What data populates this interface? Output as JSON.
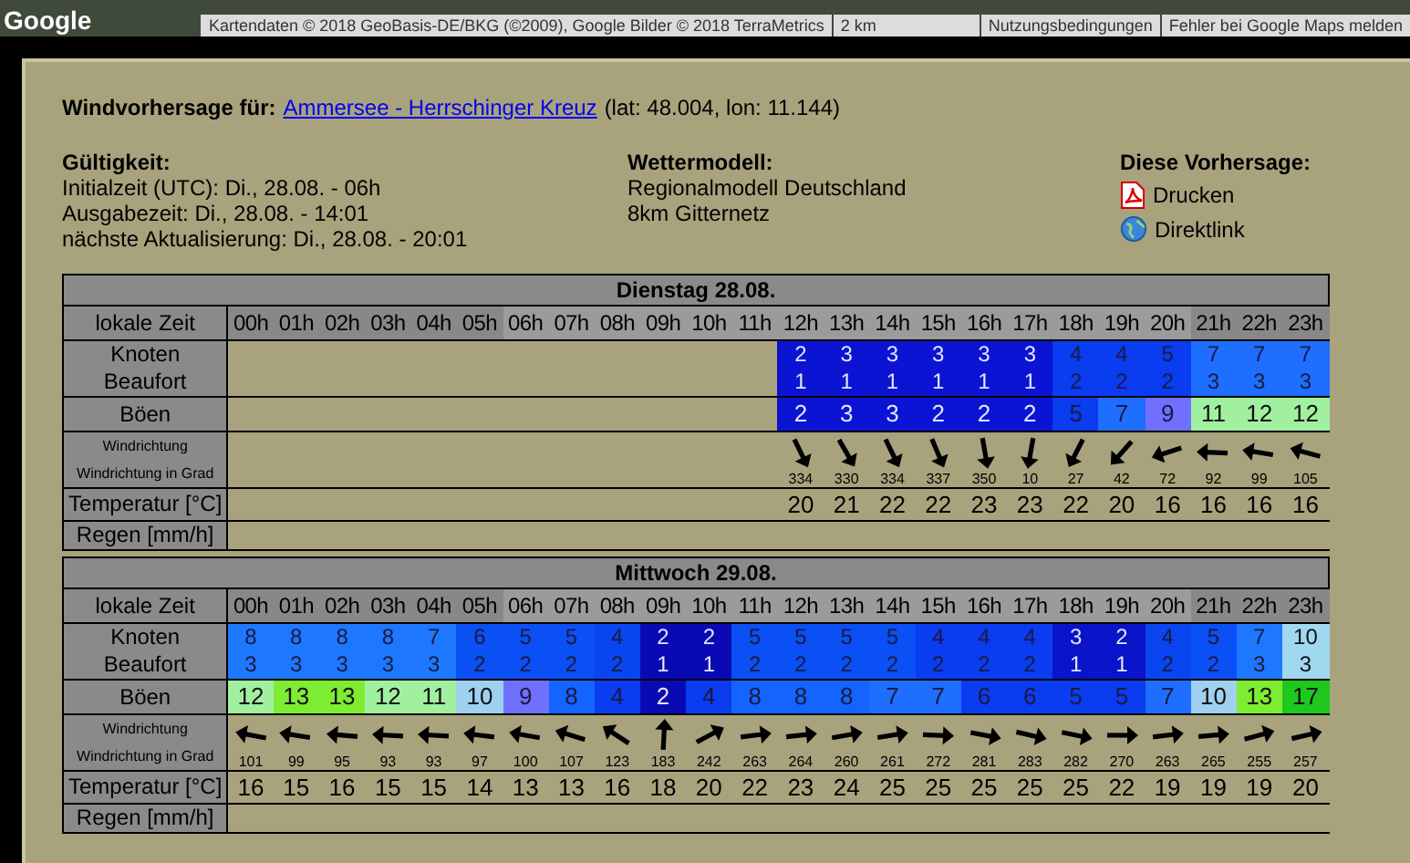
{
  "map": {
    "logo": "Google",
    "attribution": "Kartendaten © 2018 GeoBasis-DE/BKG (©2009), Google Bilder © 2018 TerraMetrics",
    "scale": "2 km",
    "terms": "Nutzungsbedingungen",
    "report": "Fehler bei Google Maps melden"
  },
  "heading": {
    "label": "Windvorhersage für:",
    "spot": "Ammersee - Herrschinger Kreuz",
    "coords": "(lat: 48.004, lon: 11.144)"
  },
  "validity": {
    "title": "Gültigkeit:",
    "lines": [
      "Initialzeit (UTC): Di., 28.08. - 06h",
      "Ausgabezeit: Di., 28.08. - 14:01",
      "nächste Aktualisierung: Di., 28.08. - 20:01"
    ]
  },
  "model": {
    "title": "Wettermodell:",
    "lines": [
      "Regionalmodell Deutschland",
      "8km Gitternetz"
    ]
  },
  "actions": {
    "title": "Diese Vorhersage:",
    "items": [
      {
        "kind": "pdf",
        "label": "Drucken"
      },
      {
        "kind": "globe",
        "label": "Direktlink"
      }
    ]
  },
  "days": [
    {
      "title": "Dienstag 28.08.",
      "row_labels": {
        "time": "lokale Zeit",
        "knots": "Knoten",
        "beaufort": "Beaufort",
        "gusts": "Böen",
        "direction": "Windrichtung",
        "direction_deg": "Windrichtung in Grad",
        "temperature": "Temperatur [°C]",
        "rain": "Regen [mm/h]"
      },
      "hours": [
        {
          "label": "00h",
          "daylight": false
        },
        {
          "label": "01h",
          "daylight": false
        },
        {
          "label": "02h",
          "daylight": false
        },
        {
          "label": "03h",
          "daylight": false
        },
        {
          "label": "04h",
          "daylight": false
        },
        {
          "label": "05h",
          "daylight": false
        },
        {
          "label": "06h",
          "daylight": true
        },
        {
          "label": "07h",
          "daylight": true
        },
        {
          "label": "08h",
          "daylight": true
        },
        {
          "label": "09h",
          "daylight": true
        },
        {
          "label": "10h",
          "daylight": true
        },
        {
          "label": "11h",
          "daylight": true
        },
        {
          "label": "12h",
          "daylight": true,
          "knots": "2",
          "beaufort": "1",
          "color": "#0a14d2",
          "gust": {
            "value": "2",
            "color": "#0a14d2"
          },
          "direction": "334",
          "temperature": "20"
        },
        {
          "label": "13h",
          "daylight": true,
          "knots": "3",
          "beaufort": "1",
          "color": "#0a14d2",
          "gust": {
            "value": "3",
            "color": "#0a14d2"
          },
          "direction": "330",
          "temperature": "21"
        },
        {
          "label": "14h",
          "daylight": true,
          "knots": "3",
          "beaufort": "1",
          "color": "#0a14d2",
          "gust": {
            "value": "3",
            "color": "#0a14d2"
          },
          "direction": "334",
          "temperature": "22"
        },
        {
          "label": "15h",
          "daylight": true,
          "knots": "3",
          "beaufort": "1",
          "color": "#0a14d2",
          "gust": {
            "value": "2",
            "color": "#0a14d2"
          },
          "direction": "337",
          "temperature": "22"
        },
        {
          "label": "16h",
          "daylight": true,
          "knots": "3",
          "beaufort": "1",
          "color": "#0a14d2",
          "gust": {
            "value": "2",
            "color": "#0a14d2"
          },
          "direction": "350",
          "temperature": "23"
        },
        {
          "label": "17h",
          "daylight": true,
          "knots": "3",
          "beaufort": "1",
          "color": "#0a14d2",
          "gust": {
            "value": "2",
            "color": "#0a14d2"
          },
          "direction": "10",
          "temperature": "23"
        },
        {
          "label": "18h",
          "daylight": true,
          "knots": "4",
          "beaufort": "2",
          "color": "#0a3cf0",
          "gust": {
            "value": "5",
            "color": "#0a3cf0"
          },
          "direction": "27",
          "temperature": "22"
        },
        {
          "label": "19h",
          "daylight": true,
          "knots": "4",
          "beaufort": "2",
          "color": "#0a3cf0",
          "gust": {
            "value": "7",
            "color": "#1e6eff"
          },
          "direction": "42",
          "temperature": "20"
        },
        {
          "label": "20h",
          "daylight": true,
          "knots": "5",
          "beaufort": "2",
          "color": "#0a3cf0",
          "gust": {
            "value": "9",
            "color": "#7070ff"
          },
          "direction": "72",
          "temperature": "16"
        },
        {
          "label": "21h",
          "daylight": false,
          "knots": "7",
          "beaufort": "3",
          "color": "#1e6eff",
          "gust": {
            "value": "11",
            "color": "#a0f0a0"
          },
          "direction": "92",
          "temperature": "16"
        },
        {
          "label": "22h",
          "daylight": false,
          "knots": "7",
          "beaufort": "3",
          "color": "#1e6eff",
          "gust": {
            "value": "12",
            "color": "#a0f0a0"
          },
          "direction": "99",
          "temperature": "16"
        },
        {
          "label": "23h",
          "daylight": false,
          "knots": "7",
          "beaufort": "3",
          "color": "#1e6eff",
          "gust": {
            "value": "12",
            "color": "#a0f0a0"
          },
          "direction": "105",
          "temperature": "16"
        }
      ]
    },
    {
      "title": "Mittwoch 29.08.",
      "row_labels": {
        "time": "lokale Zeit",
        "knots": "Knoten",
        "beaufort": "Beaufort",
        "gusts": "Böen",
        "direction": "Windrichtung",
        "direction_deg": "Windrichtung in Grad",
        "temperature": "Temperatur [°C]",
        "rain": "Regen [mm/h]"
      },
      "hours": [
        {
          "label": "00h",
          "daylight": false,
          "knots": "8",
          "beaufort": "3",
          "color": "#1e78ff",
          "gust": {
            "value": "12",
            "color": "#a0f0a0"
          },
          "direction": "101",
          "temperature": "16"
        },
        {
          "label": "01h",
          "daylight": false,
          "knots": "8",
          "beaufort": "3",
          "color": "#1e78ff",
          "gust": {
            "value": "13",
            "color": "#7dec32"
          },
          "direction": "99",
          "temperature": "15"
        },
        {
          "label": "02h",
          "daylight": false,
          "knots": "8",
          "beaufort": "3",
          "color": "#1e78ff",
          "gust": {
            "value": "13",
            "color": "#7dec32"
          },
          "direction": "95",
          "temperature": "16"
        },
        {
          "label": "03h",
          "daylight": false,
          "knots": "8",
          "beaufort": "3",
          "color": "#1e78ff",
          "gust": {
            "value": "12",
            "color": "#a0f0a0"
          },
          "direction": "93",
          "temperature": "15"
        },
        {
          "label": "04h",
          "daylight": false,
          "knots": "7",
          "beaufort": "3",
          "color": "#1e78ff",
          "gust": {
            "value": "11",
            "color": "#a0f0a0"
          },
          "direction": "93",
          "temperature": "15"
        },
        {
          "label": "05h",
          "daylight": false,
          "knots": "6",
          "beaufort": "2",
          "color": "#0a50f5",
          "gust": {
            "value": "10",
            "color": "#a0d0f0"
          },
          "direction": "97",
          "temperature": "14"
        },
        {
          "label": "06h",
          "daylight": true,
          "knots": "5",
          "beaufort": "2",
          "color": "#0a50f5",
          "gust": {
            "value": "9",
            "color": "#7070ff"
          },
          "direction": "100",
          "temperature": "13"
        },
        {
          "label": "07h",
          "daylight": true,
          "knots": "5",
          "beaufort": "2",
          "color": "#0a50f5",
          "gust": {
            "value": "8",
            "color": "#1464ff"
          },
          "direction": "107",
          "temperature": "13"
        },
        {
          "label": "08h",
          "daylight": true,
          "knots": "4",
          "beaufort": "2",
          "color": "#0a46f0",
          "gust": {
            "value": "4",
            "color": "#0a3cf0"
          },
          "direction": "123",
          "temperature": "16"
        },
        {
          "label": "09h",
          "daylight": true,
          "knots": "2",
          "beaufort": "1",
          "color": "#0a0ab4",
          "gust": {
            "value": "2",
            "color": "#0a0ab4"
          },
          "direction": "183",
          "temperature": "18"
        },
        {
          "label": "10h",
          "daylight": true,
          "knots": "2",
          "beaufort": "1",
          "color": "#0a0ab4",
          "gust": {
            "value": "4",
            "color": "#0a3cf0"
          },
          "direction": "242",
          "temperature": "20"
        },
        {
          "label": "11h",
          "daylight": true,
          "knots": "5",
          "beaufort": "2",
          "color": "#0a50f5",
          "gust": {
            "value": "8",
            "color": "#1464ff"
          },
          "direction": "263",
          "temperature": "22"
        },
        {
          "label": "12h",
          "daylight": true,
          "knots": "5",
          "beaufort": "2",
          "color": "#0a50f5",
          "gust": {
            "value": "8",
            "color": "#1464ff"
          },
          "direction": "264",
          "temperature": "23"
        },
        {
          "label": "13h",
          "daylight": true,
          "knots": "5",
          "beaufort": "2",
          "color": "#0a50f5",
          "gust": {
            "value": "8",
            "color": "#1464ff"
          },
          "direction": "260",
          "temperature": "24"
        },
        {
          "label": "14h",
          "daylight": true,
          "knots": "5",
          "beaufort": "2",
          "color": "#0a50f5",
          "gust": {
            "value": "7",
            "color": "#1e6eff"
          },
          "direction": "261",
          "temperature": "25"
        },
        {
          "label": "15h",
          "daylight": true,
          "knots": "4",
          "beaufort": "2",
          "color": "#0a3cf0",
          "gust": {
            "value": "7",
            "color": "#1e6eff"
          },
          "direction": "272",
          "temperature": "25"
        },
        {
          "label": "16h",
          "daylight": true,
          "knots": "4",
          "beaufort": "2",
          "color": "#0a3cf0",
          "gust": {
            "value": "6",
            "color": "#0a3cf0"
          },
          "direction": "281",
          "temperature": "25"
        },
        {
          "label": "17h",
          "daylight": true,
          "knots": "4",
          "beaufort": "2",
          "color": "#0a3cf0",
          "gust": {
            "value": "6",
            "color": "#0a3cf0"
          },
          "direction": "283",
          "temperature": "25"
        },
        {
          "label": "18h",
          "daylight": true,
          "knots": "3",
          "beaufort": "1",
          "color": "#0a14c8",
          "gust": {
            "value": "5",
            "color": "#0a3cf0"
          },
          "direction": "282",
          "temperature": "25"
        },
        {
          "label": "19h",
          "daylight": true,
          "knots": "2",
          "beaufort": "1",
          "color": "#0a14c8",
          "gust": {
            "value": "5",
            "color": "#0a3cf0"
          },
          "direction": "270",
          "temperature": "22"
        },
        {
          "label": "20h",
          "daylight": true,
          "knots": "4",
          "beaufort": "2",
          "color": "#0a46f0",
          "gust": {
            "value": "7",
            "color": "#1e6eff"
          },
          "direction": "263",
          "temperature": "19"
        },
        {
          "label": "21h",
          "daylight": false,
          "knots": "5",
          "beaufort": "2",
          "color": "#0a50f5",
          "gust": {
            "value": "10",
            "color": "#a0d0f0"
          },
          "direction": "265",
          "temperature": "19"
        },
        {
          "label": "22h",
          "daylight": false,
          "knots": "7",
          "beaufort": "3",
          "color": "#1e78ff",
          "gust": {
            "value": "13",
            "color": "#7dec32"
          },
          "direction": "255",
          "temperature": "19"
        },
        {
          "label": "23h",
          "daylight": false,
          "knots": "10",
          "beaufort": "3",
          "color": "#a0d8f0",
          "gust": {
            "value": "17",
            "color": "#1ec81e"
          },
          "direction": "257",
          "temperature": "20"
        }
      ]
    }
  ]
}
